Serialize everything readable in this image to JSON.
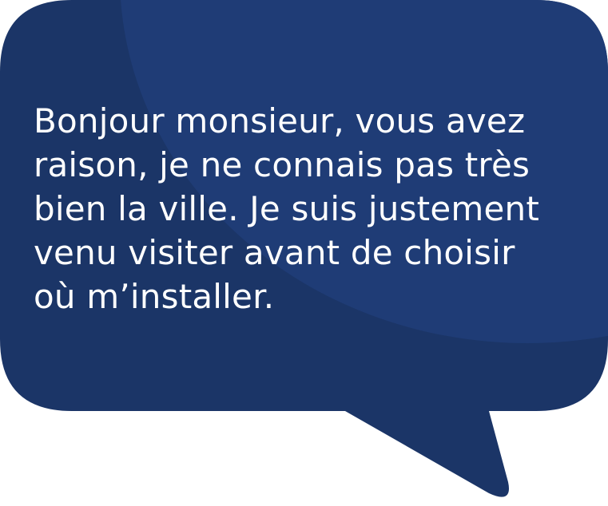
{
  "bubble": {
    "colors": {
      "base": "#1b3567",
      "highlight": "#1f3c76"
    },
    "text_lines": [
      "Bonjour monsieur, vous avez",
      "raison, je ne connais pas très",
      "bien la ville. Je suis justement",
      "venu visiter avant de choisir",
      "où m’installer."
    ]
  }
}
